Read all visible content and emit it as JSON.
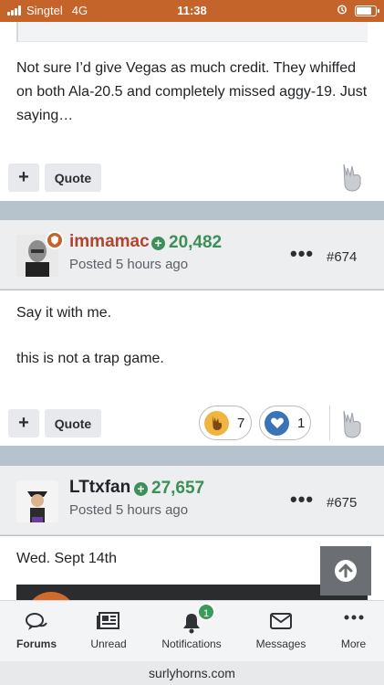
{
  "status_bar": {
    "carrier": "Singtel",
    "network": "4G",
    "time": "11:38",
    "battery_level": 0.8
  },
  "posts": [
    {
      "body": "Not sure I’d give Vegas as much credit. They whiffed on both Ala-20.5 and completely missed aggy-19. Just saying…",
      "actions": {
        "plus": "+",
        "quote": "Quote"
      }
    },
    {
      "username": "immamac",
      "username_color": "#b1442d",
      "reputation": "20,482",
      "posted": "Posted 5 hours ago",
      "post_number": "#674",
      "more": "•••",
      "body_lines": [
        "Say it with me.",
        "this is not a trap game."
      ],
      "actions": {
        "plus": "+",
        "quote": "Quote"
      },
      "reactions": [
        {
          "icon": "horns-icon",
          "count": "7"
        },
        {
          "icon": "heart-icon",
          "count": "1"
        }
      ]
    },
    {
      "username": "LTtxfan",
      "username_color": "#1f2328",
      "reputation": "27,657",
      "posted": "Posted 5 hours ago",
      "post_number": "#675",
      "more": "•••",
      "body": "Wed. Sept 14th"
    }
  ],
  "tabbar": [
    {
      "label": "Forums",
      "icon": "chat-bubbles-icon",
      "active": true
    },
    {
      "label": "Unread",
      "icon": "newspaper-icon",
      "active": false
    },
    {
      "label": "Notifications",
      "icon": "bell-icon",
      "active": false,
      "badge": "1"
    },
    {
      "label": "Messages",
      "icon": "envelope-icon",
      "active": false
    },
    {
      "label": "More",
      "icon": "ellipsis-icon",
      "active": false
    }
  ],
  "url": "surlyhorns.com",
  "colors": {
    "accent": "#c5642a",
    "reputation": "#3c8f57",
    "notif_badge": "#3c9a5c"
  }
}
